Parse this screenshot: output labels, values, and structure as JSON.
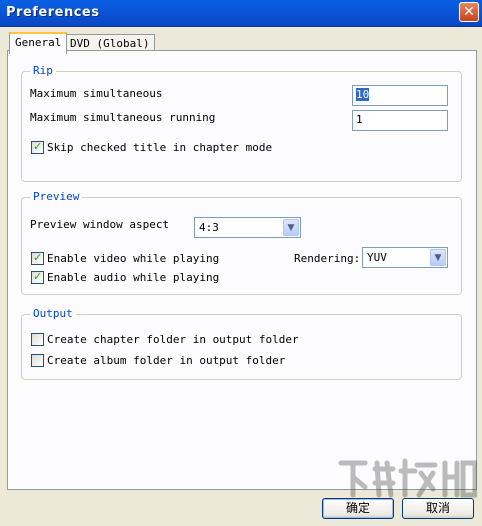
{
  "window": {
    "title": "Preferences"
  },
  "tabs": [
    {
      "label": "General"
    },
    {
      "label": "DVD (Global)"
    }
  ],
  "rip": {
    "title": "Rip",
    "max_simultaneous_label": "Maximum simultaneous",
    "max_simultaneous_value": "10",
    "max_running_label": "Maximum simultaneous running",
    "max_running_value": "1",
    "skip_checked_label": "Skip checked title in chapter mode",
    "skip_checked": true
  },
  "preview": {
    "title": "Preview",
    "aspect_label": "Preview window aspect",
    "aspect_value": "4:3",
    "enable_video_label": "Enable video while playing",
    "enable_video": true,
    "enable_audio_label": "Enable audio while playing",
    "enable_audio": true,
    "rendering_label": "Rendering:",
    "rendering_value": "YUV"
  },
  "output": {
    "title": "Output",
    "chapter_folder_label": "Create chapter folder in output folder",
    "chapter_folder": false,
    "album_folder_label": "Create album folder in output folder",
    "album_folder": false
  },
  "buttons": {
    "ok": "确定",
    "cancel": "取消"
  },
  "icons": {
    "close": "close-icon",
    "checkmark": "checkmark-icon",
    "dropdown": "chevron-down-icon"
  },
  "colors": {
    "titlebar": "#0A5FE3",
    "group_title": "#0046D5",
    "close": "#C9431C"
  }
}
